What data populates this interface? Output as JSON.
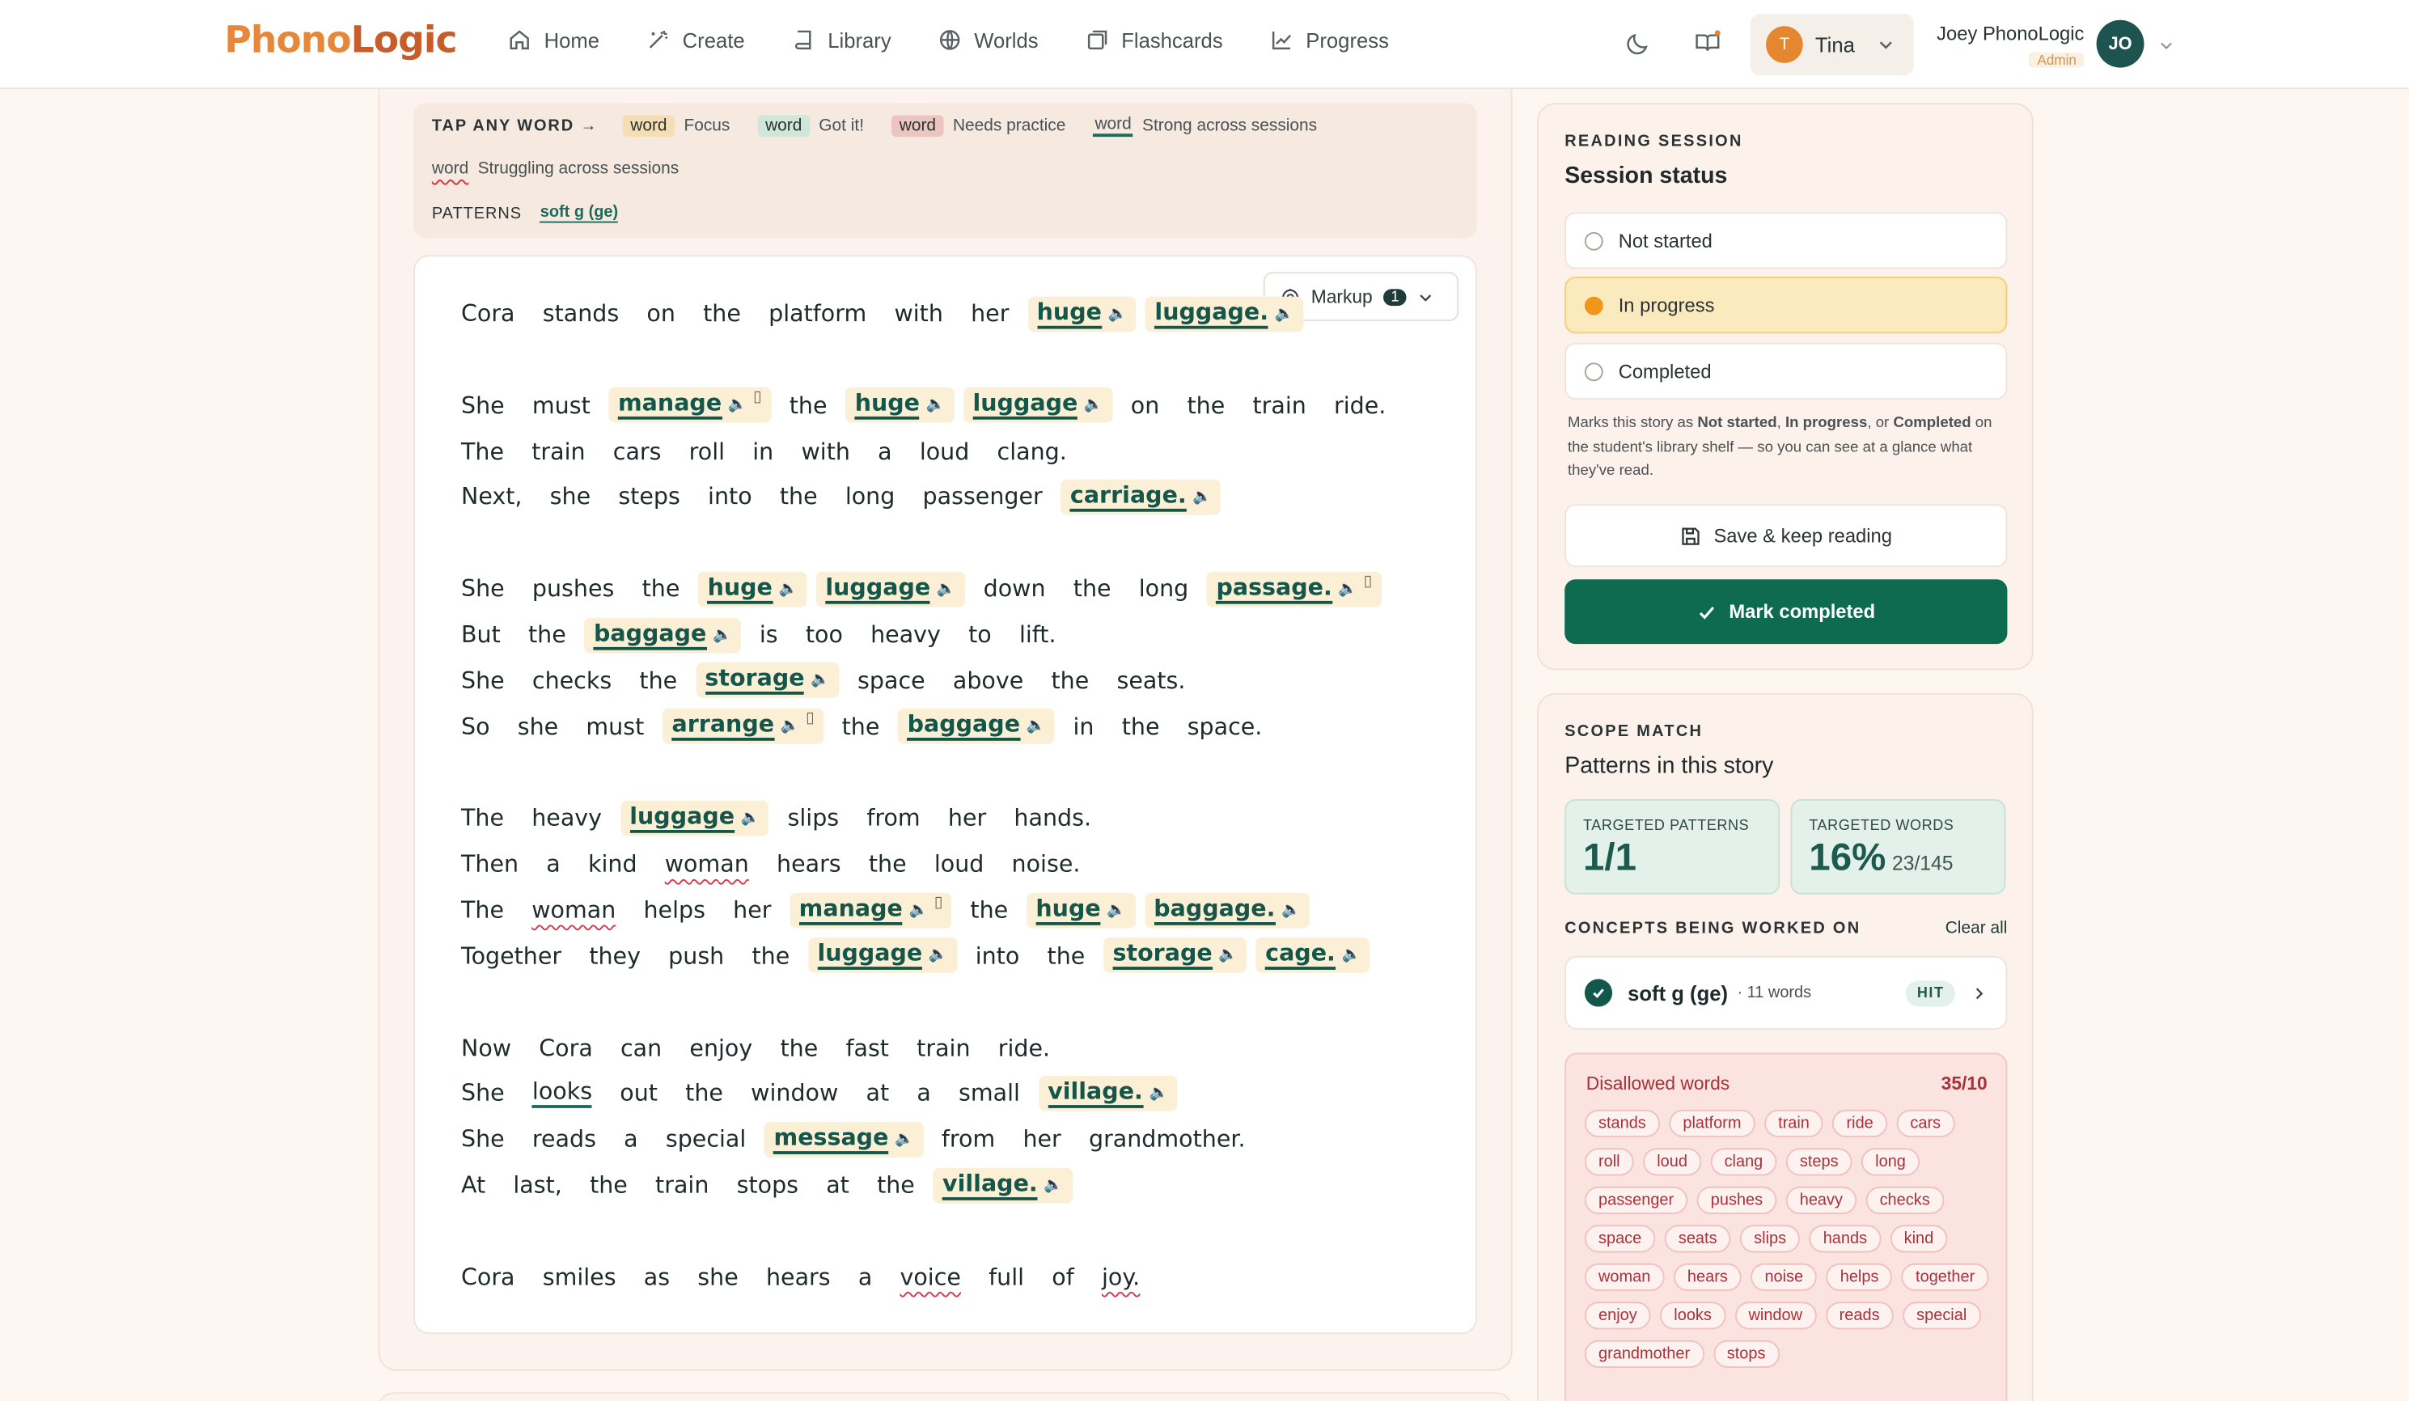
{
  "app": {
    "logo_part1": "Phono",
    "logo_part2": "Logic"
  },
  "nav": [
    {
      "label": "Home",
      "icon": "home-icon"
    },
    {
      "label": "Create",
      "icon": "wand-icon"
    },
    {
      "label": "Library",
      "icon": "book-icon"
    },
    {
      "label": "Worlds",
      "icon": "globe-icon"
    },
    {
      "label": "Flashcards",
      "icon": "cards-icon"
    },
    {
      "label": "Progress",
      "icon": "chart-icon"
    }
  ],
  "student": {
    "initial": "T",
    "name": "Tina"
  },
  "user": {
    "name": "Joey PhonoLogic",
    "role": "Admin",
    "initials": "JO"
  },
  "legend": {
    "title": "TAP ANY WORD",
    "word": "word",
    "focus": "Focus",
    "got_it": "Got it!",
    "needs_practice": "Needs practice",
    "strong": "Strong across sessions",
    "struggling": "Struggling across sessions",
    "patterns_label": "PATTERNS",
    "pattern": "soft g (ge)"
  },
  "markup": {
    "label": "Markup",
    "count": "1"
  },
  "story": [
    [
      [
        "Cora"
      ],
      [
        "stands"
      ],
      [
        "on"
      ],
      [
        "the"
      ],
      [
        "platform"
      ],
      [
        "with"
      ],
      [
        "her"
      ],
      [
        "huge",
        "h"
      ],
      [
        "luggage.",
        "h"
      ]
    ],
    [],
    [
      [
        "She"
      ],
      [
        "must"
      ],
      [
        "manage",
        "hb"
      ],
      [
        "the"
      ],
      [
        "huge",
        "h"
      ],
      [
        "luggage",
        "h"
      ],
      [
        "on"
      ],
      [
        "the"
      ],
      [
        "train"
      ],
      [
        "ride."
      ]
    ],
    [
      [
        "The"
      ],
      [
        "train"
      ],
      [
        "cars"
      ],
      [
        "roll"
      ],
      [
        "in"
      ],
      [
        "with"
      ],
      [
        "a"
      ],
      [
        "loud"
      ],
      [
        "clang."
      ]
    ],
    [
      [
        "Next,"
      ],
      [
        "she"
      ],
      [
        "steps"
      ],
      [
        "into"
      ],
      [
        "the"
      ],
      [
        "long"
      ],
      [
        "passenger"
      ],
      [
        "carriage.",
        "h"
      ]
    ],
    [],
    [
      [
        "She"
      ],
      [
        "pushes"
      ],
      [
        "the"
      ],
      [
        "huge",
        "h"
      ],
      [
        "luggage",
        "h"
      ],
      [
        "down"
      ],
      [
        "the"
      ],
      [
        "long"
      ],
      [
        "passage.",
        "hb"
      ]
    ],
    [
      [
        "But"
      ],
      [
        "the"
      ],
      [
        "baggage",
        "h"
      ],
      [
        "is"
      ],
      [
        "too"
      ],
      [
        "heavy"
      ],
      [
        "to"
      ],
      [
        "lift."
      ]
    ],
    [
      [
        "She"
      ],
      [
        "checks"
      ],
      [
        "the"
      ],
      [
        "storage",
        "h"
      ],
      [
        "space"
      ],
      [
        "above"
      ],
      [
        "the"
      ],
      [
        "seats."
      ]
    ],
    [
      [
        "So"
      ],
      [
        "she"
      ],
      [
        "must"
      ],
      [
        "arrange",
        "hb"
      ],
      [
        "the"
      ],
      [
        "baggage",
        "h"
      ],
      [
        "in"
      ],
      [
        "the"
      ],
      [
        "space."
      ]
    ],
    [],
    [
      [
        "The"
      ],
      [
        "heavy"
      ],
      [
        "luggage",
        "h"
      ],
      [
        "slips"
      ],
      [
        "from"
      ],
      [
        "her"
      ],
      [
        "hands."
      ]
    ],
    [
      [
        "Then"
      ],
      [
        "a"
      ],
      [
        "kind"
      ],
      [
        "woman",
        "s"
      ],
      [
        "hears"
      ],
      [
        "the"
      ],
      [
        "loud"
      ],
      [
        "noise."
      ]
    ],
    [
      [
        "The"
      ],
      [
        "woman",
        "s"
      ],
      [
        "helps"
      ],
      [
        "her"
      ],
      [
        "manage",
        "hb"
      ],
      [
        "the"
      ],
      [
        "huge",
        "h"
      ],
      [
        "baggage.",
        "h"
      ]
    ],
    [
      [
        "Together"
      ],
      [
        "they"
      ],
      [
        "push"
      ],
      [
        "the"
      ],
      [
        "luggage",
        "h"
      ],
      [
        "into"
      ],
      [
        "the"
      ],
      [
        "storage",
        "h"
      ],
      [
        "cage.",
        "h"
      ]
    ],
    [],
    [
      [
        "Now"
      ],
      [
        "Cora"
      ],
      [
        "can"
      ],
      [
        "enjoy"
      ],
      [
        "the"
      ],
      [
        "fast"
      ],
      [
        "train"
      ],
      [
        "ride."
      ]
    ],
    [
      [
        "She"
      ],
      [
        "looks",
        "g"
      ],
      [
        "out"
      ],
      [
        "the"
      ],
      [
        "window"
      ],
      [
        "at"
      ],
      [
        "a"
      ],
      [
        "small"
      ],
      [
        "village.",
        "h"
      ]
    ],
    [
      [
        "She"
      ],
      [
        "reads"
      ],
      [
        "a"
      ],
      [
        "special"
      ],
      [
        "message",
        "h"
      ],
      [
        "from"
      ],
      [
        "her"
      ],
      [
        "grandmother."
      ]
    ],
    [
      [
        "At"
      ],
      [
        "last,"
      ],
      [
        "the"
      ],
      [
        "train"
      ],
      [
        "stops"
      ],
      [
        "at"
      ],
      [
        "the"
      ],
      [
        "village.",
        "h"
      ]
    ],
    [],
    [
      [
        "Cora"
      ],
      [
        "smiles"
      ],
      [
        "as"
      ],
      [
        "she"
      ],
      [
        "hears"
      ],
      [
        "a"
      ],
      [
        "voice",
        "s"
      ],
      [
        "full"
      ],
      [
        "of"
      ],
      [
        "joy.",
        "s"
      ]
    ]
  ],
  "session": {
    "kicker": "READING SESSION",
    "title": "Session status",
    "options": [
      "Not started",
      "In progress",
      "Completed"
    ],
    "selected": "In progress",
    "note_a": "Marks this story as ",
    "note_b1": "Not started",
    "note_c": ", ",
    "note_b2": "In progress",
    "note_d": ", or ",
    "note_b3": "Completed",
    "note_e": " on the student's library shelf — so you can see at a glance what they've read.",
    "save_label": "Save & keep reading",
    "complete_label": "Mark completed"
  },
  "scope": {
    "kicker": "SCOPE MATCH",
    "title": "Patterns in this story",
    "targeted_patterns_label": "TARGETED PATTERNS",
    "targeted_patterns_value": "1/1",
    "targeted_words_label": "TARGETED WORDS",
    "targeted_words_value": "16%",
    "targeted_words_sub": "23/145",
    "concepts_label": "CONCEPTS BEING WORKED ON",
    "clear_all": "Clear all",
    "concept_name": "soft g (ge)",
    "concept_count": "· 11 words",
    "concept_badge": "HIT",
    "disallowed_label": "Disallowed words",
    "disallowed_count": "35/10",
    "disallowed_words": [
      "stands",
      "platform",
      "train",
      "ride",
      "cars",
      "roll",
      "loud",
      "clang",
      "steps",
      "long",
      "passenger",
      "pushes",
      "heavy",
      "checks",
      "space",
      "seats",
      "slips",
      "hands",
      "kind",
      "woman",
      "hears",
      "noise",
      "helps",
      "together",
      "enjoy",
      "looks",
      "window",
      "reads",
      "special",
      "grandmother",
      "stops"
    ]
  },
  "colors": {
    "accent": "#0f6b50",
    "focus_bg": "#fbefd6",
    "warn": "#f1961b",
    "struggle": "#d23a4a"
  }
}
